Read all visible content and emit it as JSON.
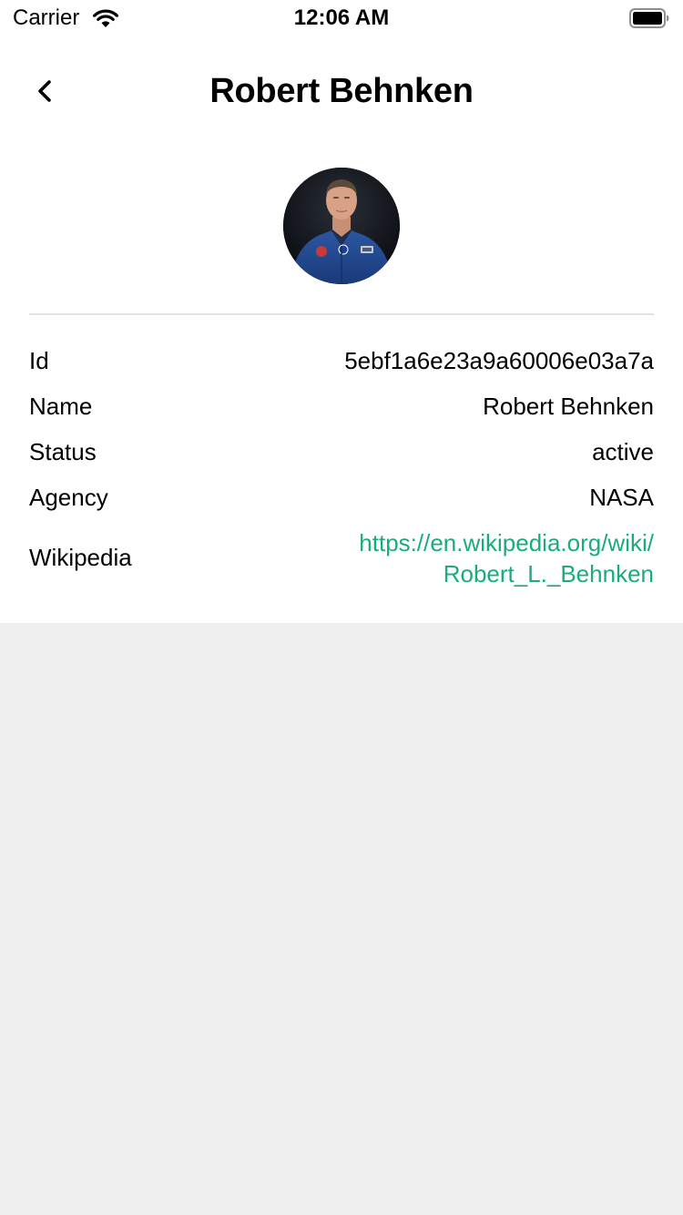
{
  "status_bar": {
    "carrier": "Carrier",
    "time": "12:06 AM"
  },
  "nav": {
    "title": "Robert Behnken",
    "back_icon": "chevron-left-icon"
  },
  "avatar": {
    "icon": "astronaut-photo"
  },
  "details": {
    "id": {
      "label": "Id",
      "value": "5ebf1a6e23a9a60006e03a7a"
    },
    "name": {
      "label": "Name",
      "value": "Robert Behnken"
    },
    "status": {
      "label": "Status",
      "value": "active"
    },
    "agency": {
      "label": "Agency",
      "value": "NASA"
    },
    "wikipedia": {
      "label": "Wikipedia",
      "value_line1": "https://en.wikipedia.org/wiki/",
      "value_line2": "Robert_L._Behnken"
    }
  },
  "colors": {
    "link": "#1aad7a",
    "background": "#efefef",
    "card": "#ffffff",
    "divider": "#e2e2e2"
  }
}
